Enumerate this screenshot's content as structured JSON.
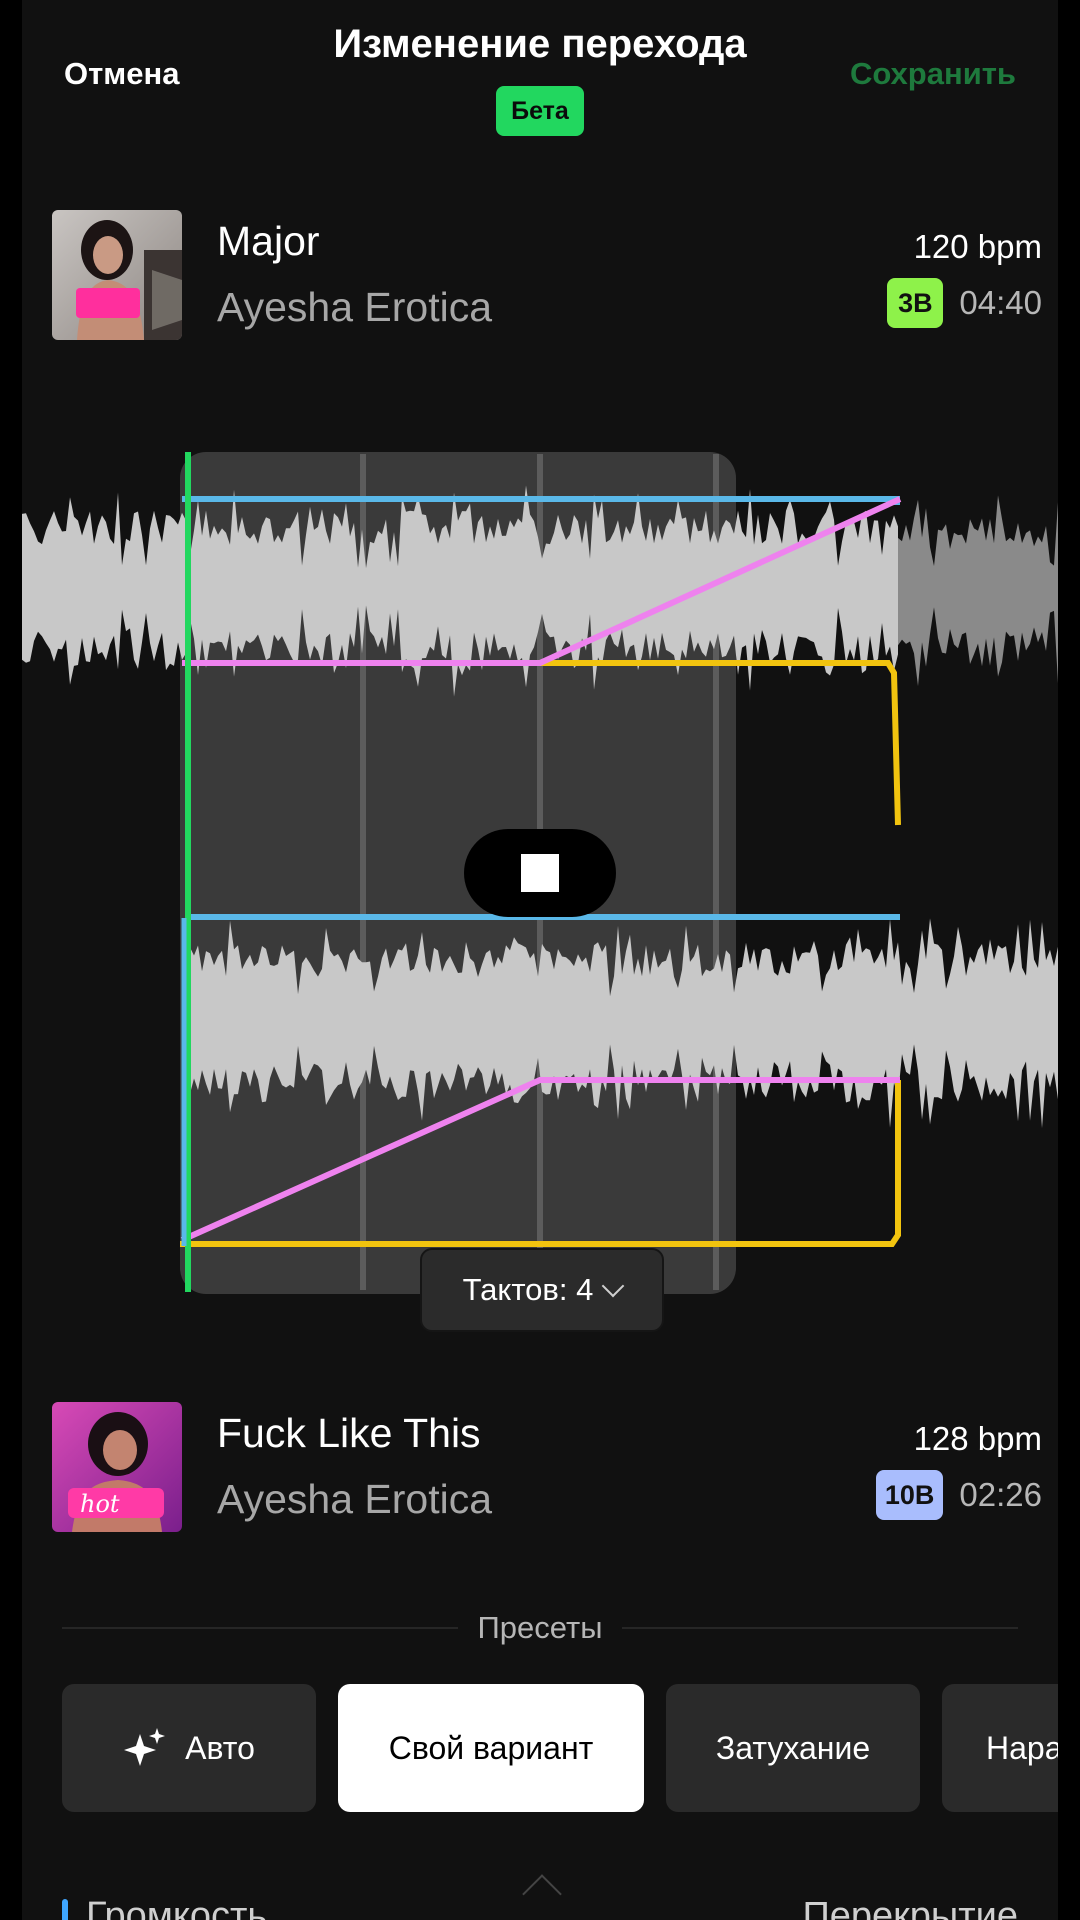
{
  "header": {
    "cancel_label": "Отмена",
    "title": "Изменение перехода",
    "beta_label": "Бета",
    "save_label": "Сохранить"
  },
  "track_a": {
    "title": "Major",
    "artist": "Ayesha Erotica",
    "bpm": "120 bpm",
    "key": "3B",
    "key_color": "#8ef24a",
    "duration": "04:40"
  },
  "track_b": {
    "title": "Fuck Like This",
    "artist": "Ayesha Erotica",
    "bpm": "128 bpm",
    "key": "10B",
    "key_color": "#a9bdfd",
    "duration": "02:26",
    "cover_text": "hot"
  },
  "editor": {
    "bars_label": "Тактов: 4",
    "colors": {
      "playhead": "#22d75f",
      "volume": "#5ab8e8",
      "highs": "#ee82ee",
      "lows": "#f2c40f"
    }
  },
  "presets": {
    "label": "Пресеты",
    "items": [
      "Авто",
      "Свой вариант",
      "Затухание",
      "Нарастание"
    ],
    "active_index": 1
  },
  "bottom": {
    "volume_label": "Громкость",
    "crossfade_label": "Перекрытие"
  }
}
